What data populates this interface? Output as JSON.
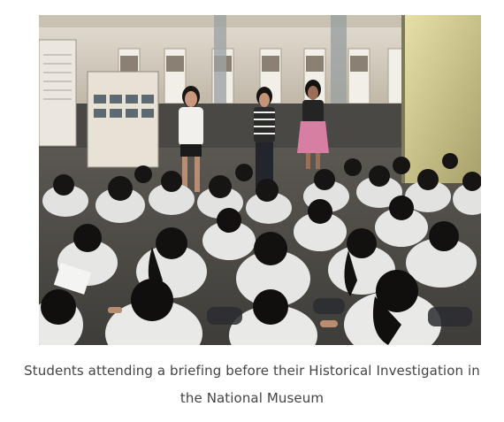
{
  "figure": {
    "caption": "Students attending a briefing before their Historical Investigation in the National Museum"
  },
  "photo": {
    "subject": "students-seated-on-floor-briefing",
    "colors": {
      "ceiling": "#d9d3c8",
      "wall": "#cfc6b6",
      "floor": "#5a5751",
      "uniform": "#e7e8e6",
      "hair": "#161412",
      "skin": "#b88d72",
      "lit_panel": "#d9d39a",
      "dress": "#d77fa2"
    }
  }
}
